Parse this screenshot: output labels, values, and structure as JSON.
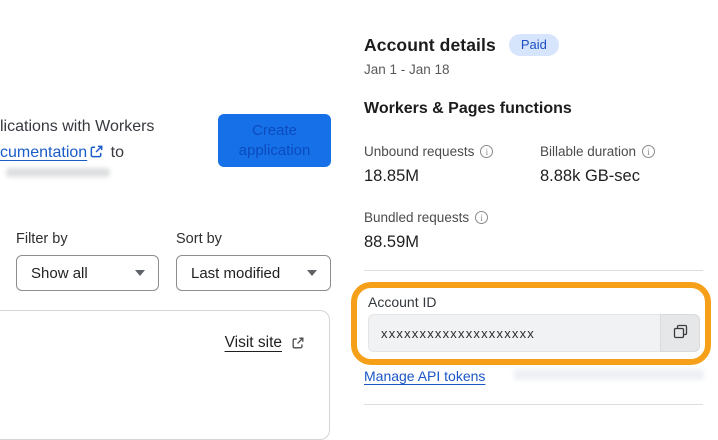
{
  "left": {
    "intro_line1": "lications with Workers",
    "intro_link_text": "cumentation",
    "intro_suffix": "to",
    "create_button_label": "Create application",
    "filter_label": "Filter by",
    "filter_value": "Show all",
    "sort_label": "Sort by",
    "sort_value": "Last modified",
    "visit_site_label": "Visit site"
  },
  "account_panel": {
    "title": "Account details",
    "badge": "Paid",
    "date_range": "Jan 1 - Jan 18",
    "section_title": "Workers & Pages functions",
    "stats": [
      {
        "label": "Unbound requests",
        "value": "18.85M"
      },
      {
        "label": "Billable duration",
        "value": "8.88k GB-sec"
      },
      {
        "label": "Bundled requests",
        "value": "88.59M"
      }
    ],
    "account_id": {
      "label": "Account ID",
      "value": "xxxxxxxxxxxxxxxxxxxx"
    },
    "manage_link_label": "Manage API tokens"
  },
  "icons": {
    "info": "i"
  },
  "colors": {
    "button_blue": "#1671e8",
    "link_blue": "#1a5cc8",
    "badge_bg": "#d7e5fc",
    "badge_text": "#1d4fc4",
    "annotation_orange": "#f6a019"
  }
}
